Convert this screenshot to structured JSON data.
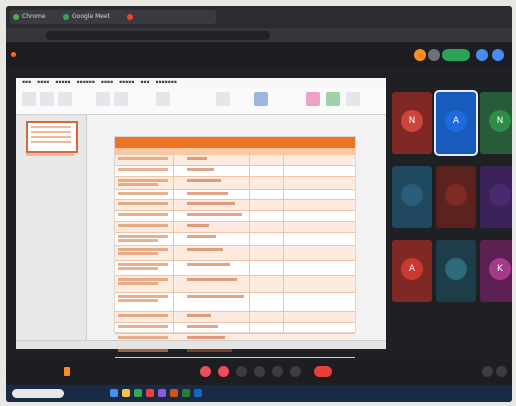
{
  "browser": {
    "tabs": [
      {
        "label": "Chrome",
        "color": "#4caf50"
      },
      {
        "label": "Google Meet",
        "color": "#34a853"
      },
      {
        "label": "",
        "color": "#ea4335"
      }
    ],
    "url": ""
  },
  "meeting": {
    "title": "",
    "join_pill": "",
    "time": "",
    "end_label": ""
  },
  "slide": {
    "title": "",
    "subtitle_left": "",
    "subtitle_mid": "",
    "subtitle_right": ""
  },
  "participants": [
    {
      "initial": "N",
      "name": "",
      "color": "#c9473d",
      "bg": "#7d2a25"
    },
    {
      "initial": "A",
      "name": "",
      "color": "#1e6bd6",
      "bg": "#1a5bb8"
    },
    {
      "initial": "N",
      "name": "",
      "color": "#2f8b4a",
      "bg": "#2a5a3a"
    },
    {
      "initial": "",
      "name": "",
      "color": "#2c5d7a",
      "bg": "#22485e"
    },
    {
      "initial": "",
      "name": "",
      "color": "#7c2b24",
      "bg": "#5a2320"
    },
    {
      "initial": "",
      "name": "",
      "color": "#4a2a6e",
      "bg": "#3a2256"
    },
    {
      "initial": "A",
      "name": "",
      "color": "#c43a34",
      "bg": "#7d2a25"
    },
    {
      "initial": "",
      "name": "",
      "color": "#2d6a7a",
      "bg": "#1e3e48"
    },
    {
      "initial": "K",
      "name": "",
      "color": "#a33a8a",
      "bg": "#5a2150"
    }
  ],
  "taskbar": {
    "search": "",
    "clock": ""
  },
  "colors": {
    "accent": "#e8742c",
    "meet_bg": "#1d1e22"
  }
}
